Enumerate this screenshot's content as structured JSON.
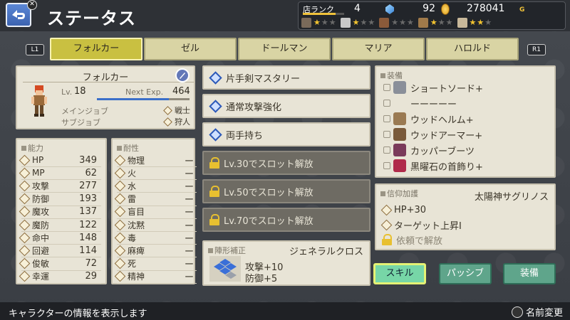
{
  "header": {
    "title": "ステータス",
    "close_glyph": "✕",
    "shop_rank_label": "店ランク",
    "shop_rank_value": "4",
    "shop_rank_progress": 0.8,
    "gems": "92",
    "gold": "278041",
    "gold_unit": "G",
    "tools": [
      {
        "icon": "pickaxe-icon",
        "stars_on": 1,
        "stars_total": 3
      },
      {
        "icon": "bug-net-icon",
        "stars_on": 1,
        "stars_total": 3
      },
      {
        "icon": "fishing-rod-icon",
        "stars_on": 0,
        "stars_total": 3
      },
      {
        "icon": "cutting-board-icon",
        "stars_on": 1,
        "stars_total": 3
      },
      {
        "icon": "sewing-icon",
        "stars_on": 2,
        "stars_total": 3
      }
    ]
  },
  "tabs": {
    "left_button": "L1",
    "right_button": "R1",
    "items": [
      {
        "label": "フォルカー",
        "active": true
      },
      {
        "label": "ゼル",
        "active": false
      },
      {
        "label": "ドールマン",
        "active": false
      },
      {
        "label": "マリア",
        "active": false
      },
      {
        "label": "ハロルド",
        "active": false
      }
    ]
  },
  "character": {
    "name": "フォルカー",
    "level_label": "Lv.",
    "level": "18",
    "next_exp_label": "Next Exp.",
    "next_exp": "464",
    "exp_progress": 0.78,
    "main_job_label": "メインジョブ",
    "main_job": "戦士",
    "sub_job_label": "サブジョブ",
    "sub_job": "狩人"
  },
  "abilities": {
    "title": "能力",
    "rows": [
      {
        "label": "HP",
        "value": "349"
      },
      {
        "label": "MP",
        "value": "62"
      },
      {
        "label": "攻撃",
        "value": "277"
      },
      {
        "label": "防御",
        "value": "193"
      },
      {
        "label": "魔攻",
        "value": "137"
      },
      {
        "label": "魔防",
        "value": "122"
      },
      {
        "label": "命中",
        "value": "148"
      },
      {
        "label": "回避",
        "value": "114"
      },
      {
        "label": "俊敏",
        "value": "72"
      },
      {
        "label": "幸運",
        "value": "29"
      }
    ]
  },
  "resistances": {
    "title": "耐性",
    "rows": [
      {
        "label": "物理",
        "value": "ー"
      },
      {
        "label": "火",
        "value": "ー"
      },
      {
        "label": "水",
        "value": "ー"
      },
      {
        "label": "雷",
        "value": "ー"
      },
      {
        "label": "盲目",
        "value": "ー"
      },
      {
        "label": "沈黙",
        "value": "ー"
      },
      {
        "label": "毒",
        "value": "ー"
      },
      {
        "label": "麻痺",
        "value": "ー"
      },
      {
        "label": "死",
        "value": "ー"
      },
      {
        "label": "精神",
        "value": "ー"
      }
    ]
  },
  "skills": [
    {
      "label": "片手剣マスタリー",
      "locked": false
    },
    {
      "label": "通常攻撃強化",
      "locked": false
    },
    {
      "label": "両手持ち",
      "locked": false
    },
    {
      "label": "Lv.30でスロット解放",
      "locked": true
    },
    {
      "label": "Lv.50でスロット解放",
      "locked": true
    },
    {
      "label": "Lv.70でスロット解放",
      "locked": true
    }
  ],
  "formation": {
    "title": "陣形補正",
    "name": "ジェネラルクロス",
    "bonus1": "攻撃+10",
    "bonus2": "防御+5"
  },
  "equipment": {
    "title": "装備",
    "rows": [
      {
        "name": "ショートソード+",
        "icon": "sword-icon",
        "color": "#8a8f99"
      },
      {
        "name": "ーーーーー",
        "icon": "empty-slot-icon",
        "color": "#e8e4d6"
      },
      {
        "name": "ウッドヘルム+",
        "icon": "helmet-icon",
        "color": "#9a7a52"
      },
      {
        "name": "ウッドアーマー+",
        "icon": "armor-icon",
        "color": "#7a5a3a"
      },
      {
        "name": "カッパーブーツ",
        "icon": "boots-icon",
        "color": "#7a3a5a"
      },
      {
        "name": "黒曜石の首飾り+",
        "icon": "necklace-icon",
        "color": "#b02a4a"
      }
    ]
  },
  "faith": {
    "title": "信仰加護",
    "deity": "太陽神サグリノス",
    "rows": [
      {
        "label": "HP+30",
        "locked": false
      },
      {
        "label": "ターゲット上昇Ⅰ",
        "locked": false
      },
      {
        "label": "依頼で解放",
        "locked": true
      }
    ]
  },
  "actions": {
    "skill": "スキル",
    "passive": "パッシブ",
    "equip": "装備"
  },
  "footer": {
    "hint": "キャラクターの情報を表示します",
    "rename": "名前変更"
  },
  "colors": {
    "tab_active": "#c9c041",
    "panel_bg": "#e8e4d6",
    "locked_bg": "#6e6b63",
    "action_button": "#5fa58b",
    "accent_gold": "#f0c23a"
  }
}
